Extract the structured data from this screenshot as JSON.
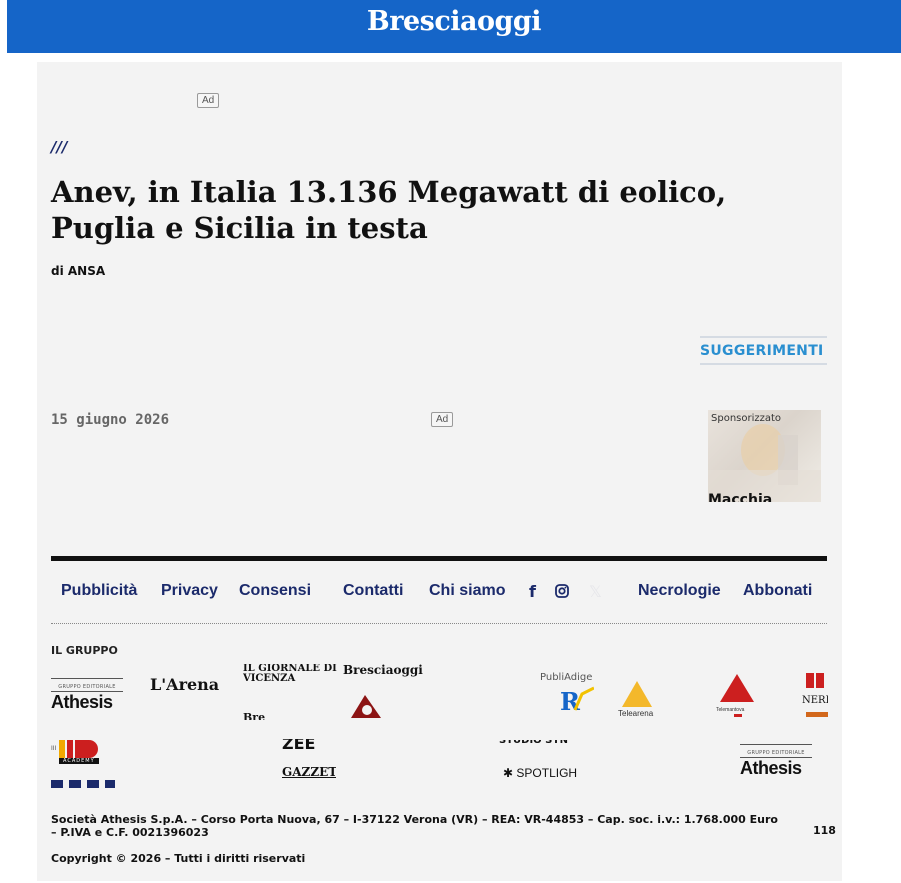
{
  "header": {
    "logo": "Bresciaoggi",
    "brand_color": "#1565c8"
  },
  "ads": {
    "label": "Ad"
  },
  "article": {
    "section_mark": "///",
    "title": "Anev, in Italia 13.136 Megawatt di eolico, Puglia e Sicilia in testa",
    "byline": "di ANSA",
    "date": "15 giugno 2026"
  },
  "suggestions": {
    "heading": "SUGGERIMENTI",
    "card": {
      "label": "Sponsorizzato",
      "title": "Macchia"
    }
  },
  "footer": {
    "links": [
      "Pubblicità",
      "Privacy",
      "Consensi",
      "Contatti",
      "Chi siamo",
      "Necrologie",
      "Abbonati"
    ],
    "social": {
      "facebook": "f",
      "x": "𝕏"
    },
    "gruppo_heading": "IL GRUPPO",
    "brands": {
      "athesis_tag": "GRUPPO EDITORIALE",
      "athesis": "Athesis",
      "larena": "L'Arena",
      "giornale_vicenza": "IL GIORNALE DI VICENZA",
      "bresciaoggi": "Bresciaoggi",
      "publiadige": "PubliAdige",
      "telearena": "Telearena",
      "telemantova": "Telemantova",
      "neri_pozza": "NERI PO",
      "academy": "ACADEMY",
      "gazzetta": "GAZZETT",
      "spotlight": "SPOTLIGH",
      "athesis2_tag": "GRUPPO EDITORIALE",
      "athesis2": "Athesis"
    },
    "company": "Società Athesis S.p.A. – Corso Porta Nuova, 67 – I-37122 Verona (VR) – REA: VR-44853 – Cap. soc. i.v.: 1.768.000 Euro – P.IVA e C.F. 0021396023",
    "page_number": "118",
    "copyright": "Copyright © 2026 – Tutti i diritti riservati"
  }
}
